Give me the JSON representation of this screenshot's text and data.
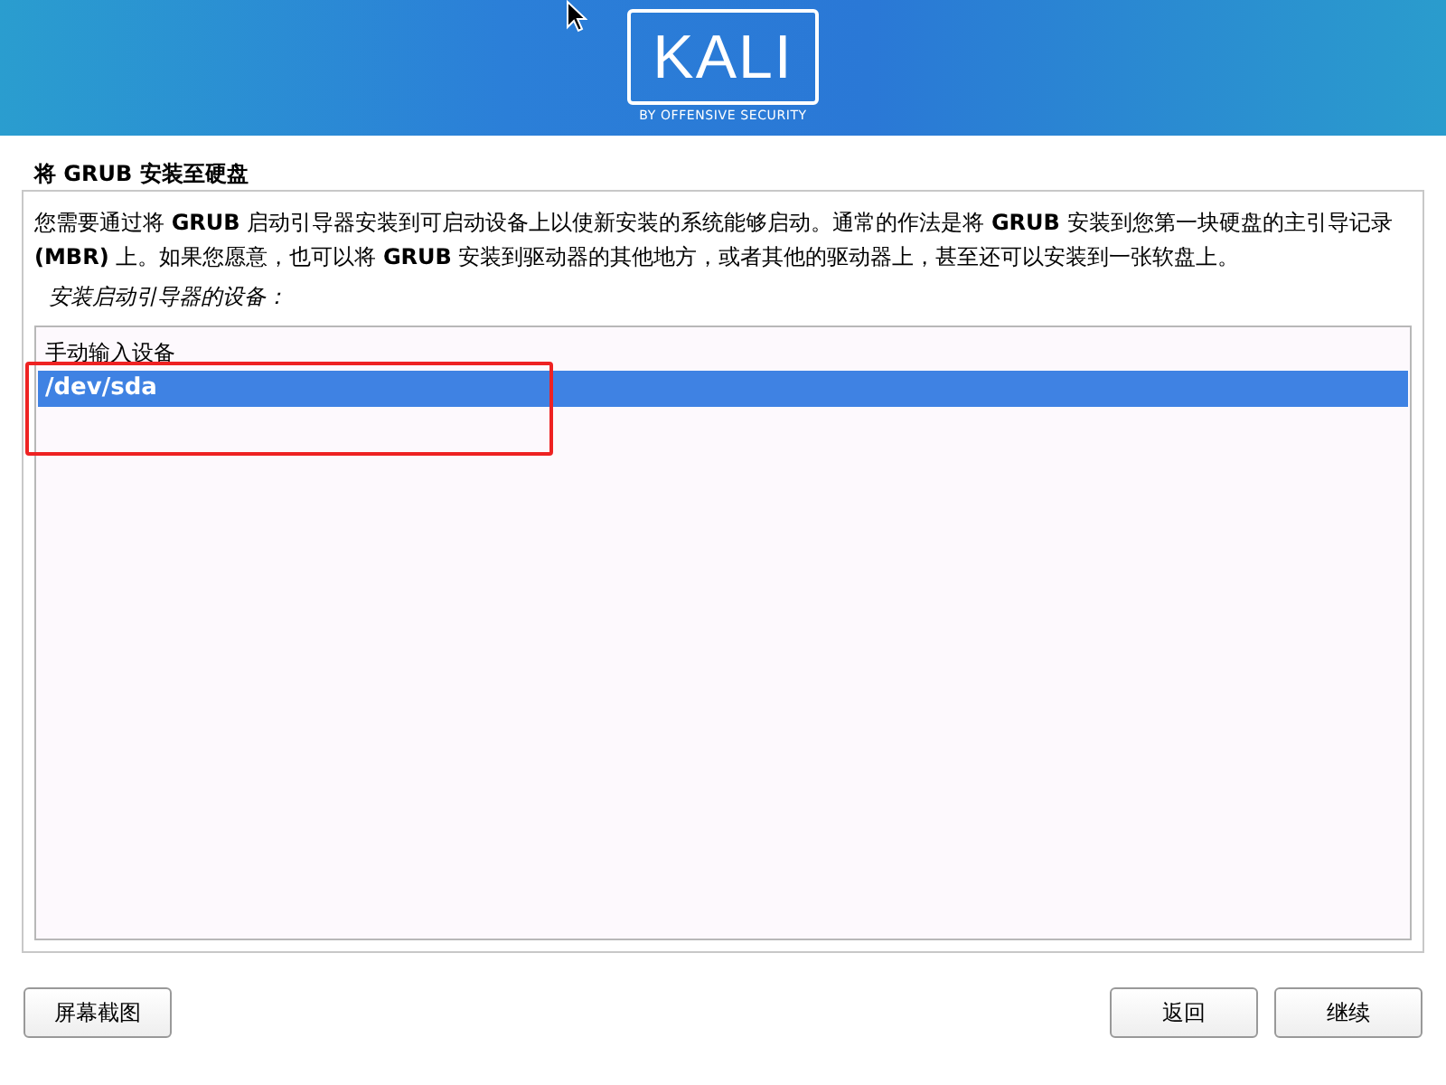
{
  "header": {
    "logo_text": "KALI",
    "tagline": "BY OFFENSIVE SECURITY"
  },
  "title": "将 GRUB 安装至硬盘",
  "description": "您需要通过将 **GRUB** 启动引导器安装到可启动设备上以使新安装的系统能够启动。通常的作法是将 **GRUB** 安装到您第一块硬盘的主引导记录 **(MBR)** 上。如果您愿意，也可以将 **GRUB** 安装到驱动器的其他地方，或者其他的驱动器上，甚至还可以安装到一张软盘上。",
  "list_label": "安装启动引导器的设备：",
  "devices": [
    {
      "label": "手动输入设备",
      "selected": false
    },
    {
      "label": "/dev/sda",
      "selected": true
    }
  ],
  "buttons": [
    {
      "label": "屏幕截图",
      "kind": "left"
    },
    {
      "label": "返回",
      "kind": "right"
    },
    {
      "label": "继续",
      "kind": "right"
    }
  ]
}
